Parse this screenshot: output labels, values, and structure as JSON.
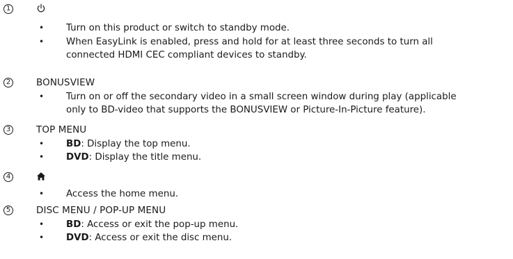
{
  "items": [
    {
      "number": "1",
      "icon": "power-icon",
      "bullets": [
        [
          "Turn on this product or switch to standby mode."
        ],
        [
          "When EasyLink is enabled, press and hold for at least three seconds to turn all",
          "connected HDMI CEC compliant devices to standby."
        ]
      ]
    },
    {
      "number": "2",
      "heading": "BONUSVIEW",
      "bullets": [
        [
          "Turn on or off the secondary video in a small screen window during play (applicable",
          "only to BD-video that supports the BONUSVIEW or Picture-In-Picture feature)."
        ]
      ]
    },
    {
      "number": "3",
      "heading": "TOP MENU",
      "bullets": [
        {
          "term": "BD",
          "text": ": Display the top menu."
        },
        {
          "term": "DVD",
          "text": ": Display the title menu."
        }
      ]
    },
    {
      "number": "4",
      "icon": "home-icon",
      "bullets": [
        [
          "Access the home menu."
        ]
      ]
    },
    {
      "number": "5",
      "heading": "DISC MENU / POP-UP MENU",
      "bullets": [
        {
          "term": "BD",
          "text": ": Access or exit the pop-up menu."
        },
        {
          "term": "DVD",
          "text": ": Access or exit the disc menu."
        }
      ]
    }
  ],
  "bullet_glyph": "•"
}
